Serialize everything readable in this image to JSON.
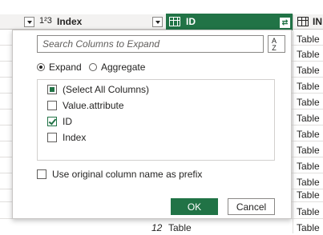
{
  "columns": {
    "index": {
      "type_label": "1²3",
      "name": "Index"
    },
    "id": {
      "name": "ID"
    },
    "third": {
      "name": "IN"
    }
  },
  "table_cells": [
    "Table",
    "Table",
    "Table",
    "Table",
    "Table",
    "Table",
    "Table",
    "Table",
    "Table",
    "Table",
    "Table",
    "Table",
    "Table"
  ],
  "last_row": {
    "number": "12",
    "value": "Table"
  },
  "dialog": {
    "search_placeholder": "Search Columns to Expand",
    "sort_button": "A Z",
    "expand_label": "Expand",
    "aggregate_label": "Aggregate",
    "mode_selected": "Expand",
    "items": [
      {
        "label": "(Select All Columns)",
        "state": "partial"
      },
      {
        "label": "Value.attribute",
        "state": "unchecked"
      },
      {
        "label": "ID",
        "state": "checked"
      },
      {
        "label": "Index",
        "state": "unchecked"
      }
    ],
    "prefix_label": "Use original column name as prefix",
    "prefix_checked": false,
    "ok_label": "OK",
    "cancel_label": "Cancel"
  },
  "colors": {
    "accent": "#217346"
  }
}
